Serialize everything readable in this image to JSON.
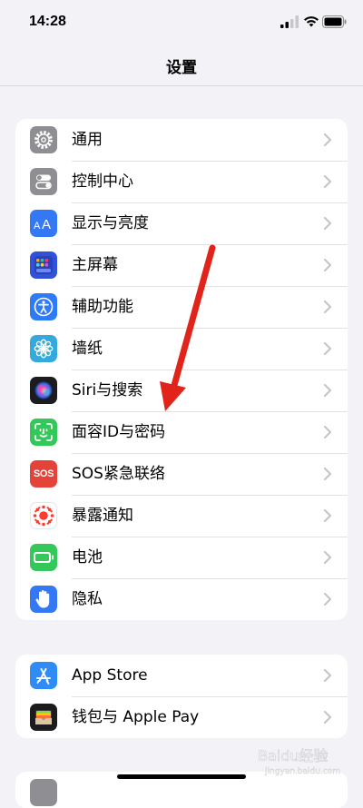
{
  "status_bar": {
    "time": "14:28"
  },
  "nav": {
    "title": "设置"
  },
  "groups": [
    {
      "items": [
        {
          "label": "通用",
          "icon": "gear-icon",
          "color": "#8e8e93"
        },
        {
          "label": "控制中心",
          "icon": "toggles-icon",
          "color": "#8e8e93"
        },
        {
          "label": "显示与亮度",
          "icon": "text-size-icon",
          "color": "#3478f6"
        },
        {
          "label": "主屏幕",
          "icon": "home-grid-icon",
          "color": "#3151d8"
        },
        {
          "label": "辅助功能",
          "icon": "accessibility-icon",
          "color": "#2f7bf5"
        },
        {
          "label": "墙纸",
          "icon": "flower-icon",
          "color": "#34aadc"
        },
        {
          "label": "Siri与搜索",
          "icon": "siri-icon",
          "color": "#1c1c1e"
        },
        {
          "label": "面容ID与密码",
          "icon": "face-id-icon",
          "color": "#34c759"
        },
        {
          "label": "SOS紧急联络",
          "icon": "sos-icon",
          "color": "#e5433a",
          "icon_text": "SOS"
        },
        {
          "label": "暴露通知",
          "icon": "exposure-icon",
          "color": "#ffffff"
        },
        {
          "label": "电池",
          "icon": "battery-icon",
          "color": "#34c759"
        },
        {
          "label": "隐私",
          "icon": "hand-icon",
          "color": "#3478f6"
        }
      ]
    },
    {
      "items": [
        {
          "label": "App Store",
          "icon": "app-store-icon",
          "color": "#2f8cf6"
        },
        {
          "label": "钱包与 Apple Pay",
          "icon": "wallet-icon",
          "color": "#1c1c1e"
        }
      ]
    }
  ],
  "annotation": {
    "arrow_color": "#e2231a"
  },
  "watermark": {
    "text": "Baidu经验",
    "sub": "jingyan.baidu.com"
  }
}
